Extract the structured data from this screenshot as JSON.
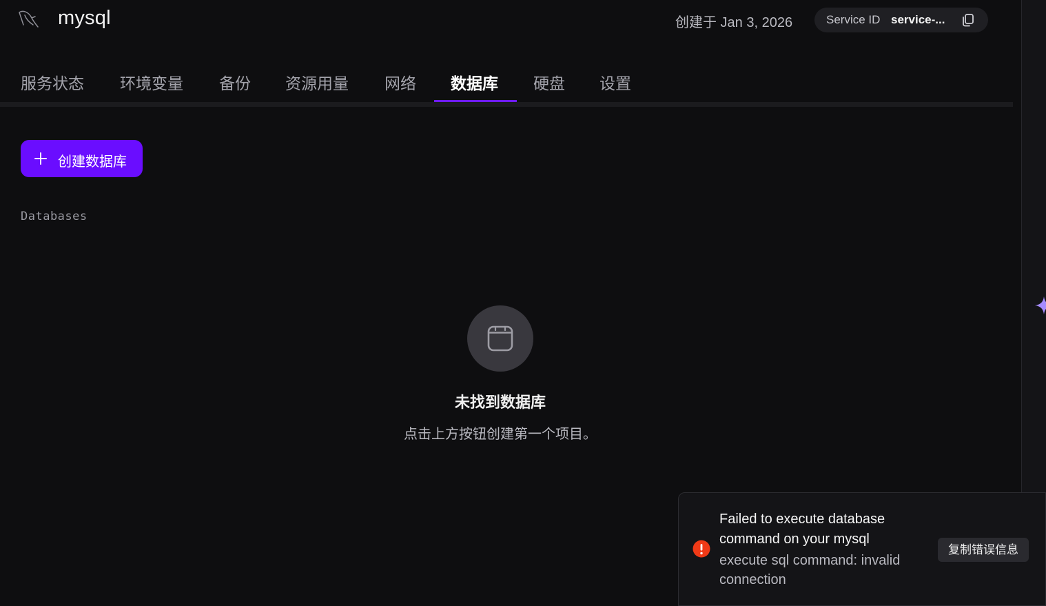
{
  "header": {
    "service_name": "mysql",
    "created_text": "创建于 Jan 3, 2026",
    "service_id_label": "Service ID",
    "service_id_value": "service-..."
  },
  "tabs": [
    {
      "label": "服务状态"
    },
    {
      "label": "环境变量"
    },
    {
      "label": "备份"
    },
    {
      "label": "资源用量"
    },
    {
      "label": "网络"
    },
    {
      "label": "数据库",
      "active": true
    },
    {
      "label": "硬盘"
    },
    {
      "label": "设置"
    }
  ],
  "create_button": {
    "label": "创建数据库"
  },
  "databases_section": {
    "label": "Databases"
  },
  "empty_state": {
    "title": "未找到数据库",
    "subtitle": "点击上方按钮创建第一个项目。"
  },
  "toast": {
    "title": "Failed to execute database command on your mysql",
    "message": "execute sql command: invalid connection",
    "copy_button": "复制错误信息"
  },
  "colors": {
    "accent": "#6a0dff",
    "error": "#f03a17",
    "background": "#0e0e10"
  },
  "icons": {
    "logo": "mysql-dolphin-icon",
    "copy": "copy-icon",
    "create": "plus-icon",
    "empty": "database-icon",
    "error": "error-icon",
    "assistant": "sparkle-icon"
  }
}
